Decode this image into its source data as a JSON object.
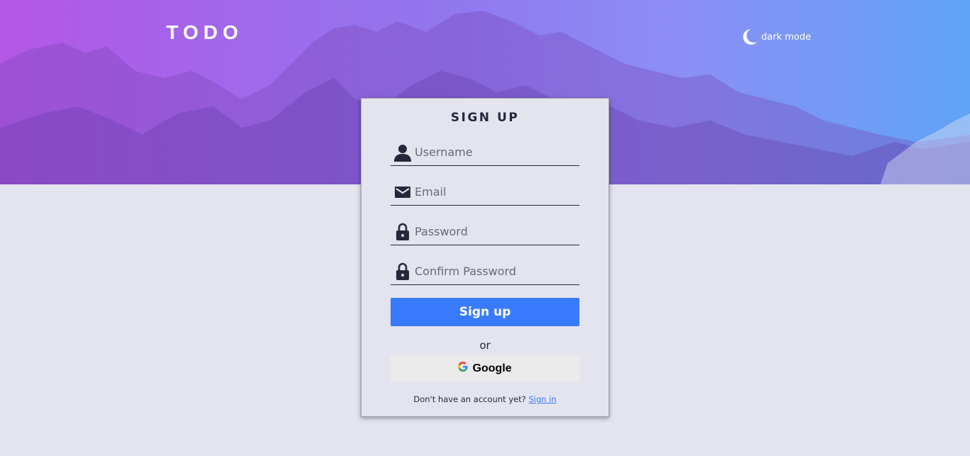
{
  "app": {
    "logo": "TODO"
  },
  "header": {
    "theme_toggle_label": "dark mode"
  },
  "signup": {
    "title": "SIGN UP",
    "fields": {
      "username_placeholder": "Username",
      "email_placeholder": "Email",
      "password_placeholder": "Password",
      "confirm_password_placeholder": "Confirm Password"
    },
    "submit_label": "Sign up",
    "divider": "or",
    "google_label": "Google",
    "footer_prompt": "Don't have an account yet?",
    "footer_link": "Sign in"
  },
  "colors": {
    "accent": "#3a7bfd",
    "text_dark": "#25273c",
    "page_bg": "#e4e4ef",
    "gradient_start": "#b457e6",
    "gradient_end": "#5fa4f5"
  },
  "icons": [
    "moon-icon",
    "user-icon",
    "mail-icon",
    "lock-icon",
    "google-icon"
  ]
}
